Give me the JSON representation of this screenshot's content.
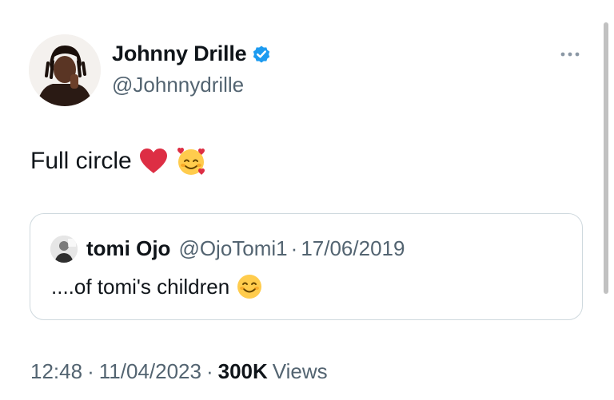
{
  "tweet": {
    "author": {
      "name": "Johnny Drille",
      "handle": "@Johnnydrille",
      "verified": true
    },
    "text": "Full circle",
    "emojis": [
      "red-heart",
      "smiling-face-with-hearts"
    ],
    "time": "12:48",
    "date": "11/04/2023",
    "views_count": "300K",
    "views_label": "Views",
    "separator": "·"
  },
  "quoted_tweet": {
    "name": "tomi Ojo",
    "handle": "@OjoTomi1",
    "date": "17/06/2019",
    "text": "....of tomi's children",
    "emoji": "smiling-face-with-smiling-eyes"
  },
  "colors": {
    "primary_text": "#0f1419",
    "secondary_text": "#536471",
    "verified_blue": "#1d9bf0",
    "border": "#cfd9de"
  }
}
